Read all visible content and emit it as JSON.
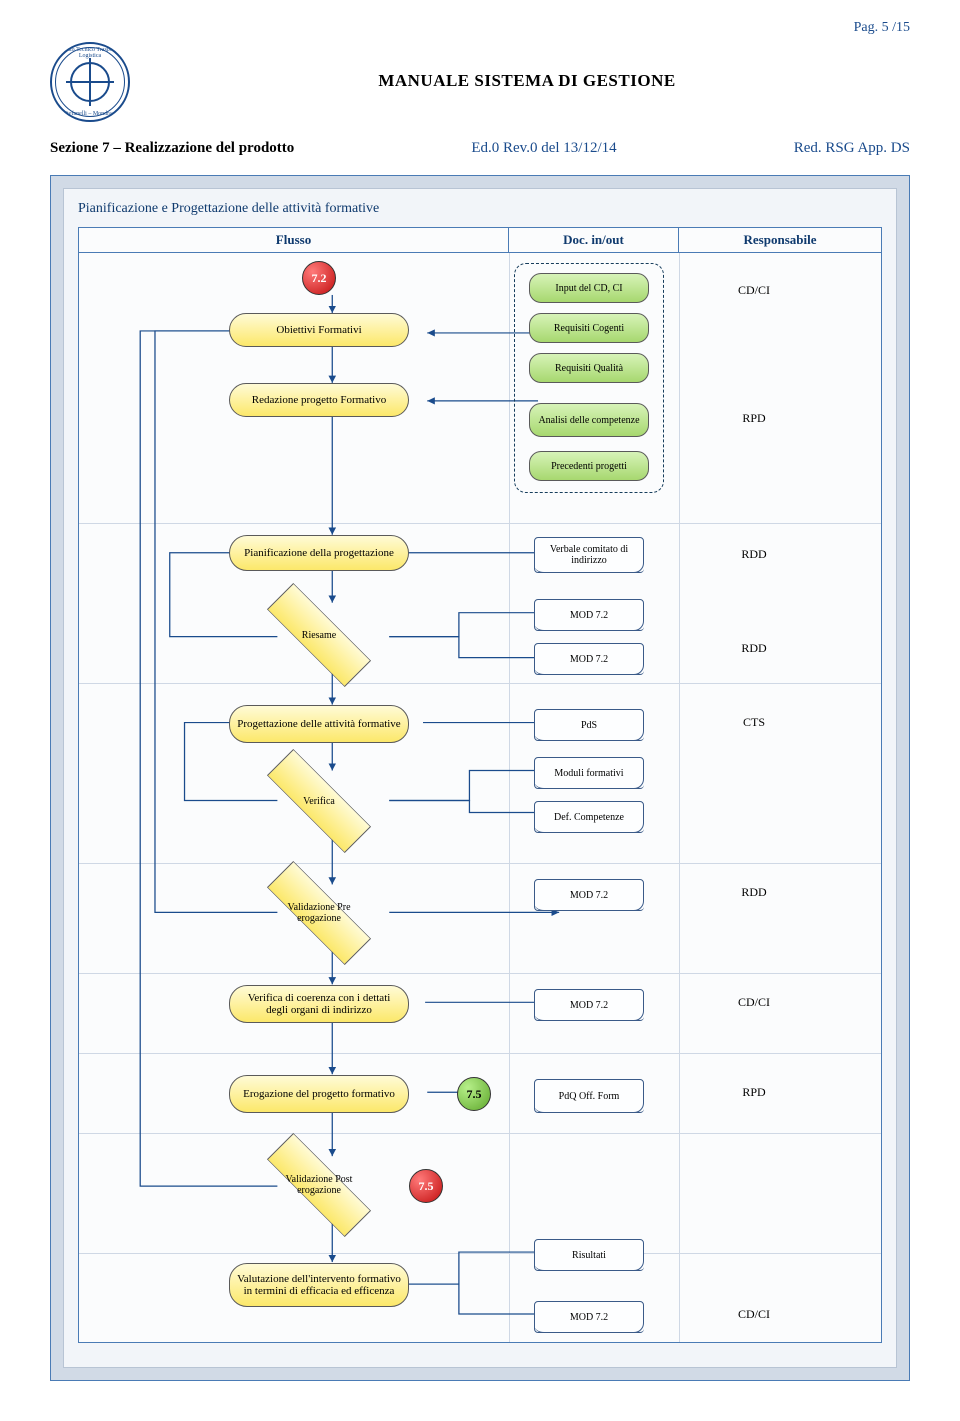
{
  "page_no": "Pag. 5 /15",
  "doc_title": "MANUALE SISTEMA DI GESTIONE",
  "section": "Sezione 7 – Realizzazione del prodotto",
  "ed": "Ed.0 Rev.0 del 13/12/14",
  "red": "Red. RSG App. DS",
  "logo": {
    "top": "Istituto Tecnico Trasporti e Logistica",
    "bottom": "N. Stefanelli – Mondragone"
  },
  "panel_title": "Pianificazione e Progettazione delle attività formative",
  "hdr": {
    "c1": "Flusso",
    "c2": "Doc. in/out",
    "c3": "Responsabile"
  },
  "term1": "7.2",
  "term2": "7.5",
  "term3": "7.5",
  "proc": {
    "obiettivi": "Obiettivi Formativi",
    "redazione": "Redazione progetto Formativo",
    "pianif": "Pianificazione della progettazione",
    "riesame": "Riesame",
    "progett": "Progettazione delle attività formative",
    "verifica": "Verifica",
    "validpre": "Validazione Pre erogazione",
    "vercoer": "Verifica di coerenza con i dettati degli organi di indirizzo",
    "erog": "Erogazione del progetto formativo",
    "validpost": "Validazione Post erogazione",
    "valut": "Valutazione dell'intervento formativo in termini di efficacia ed efficenza"
  },
  "inp": {
    "input": "Input del CD, CI",
    "cogenti": "Requisiti Cogenti",
    "qualita": "Requisiti Qualità",
    "analisi": "Analisi delle competenze",
    "precedenti": "Precedenti progetti"
  },
  "doc": {
    "verbale": "Verbale comitato di indirizzo",
    "mod72a": "MOD 7.2",
    "mod72b": "MOD 7.2",
    "pds": "PdS",
    "moduli": "Moduli formativi",
    "defcomp": "Def. Competenze",
    "mod72c": "MOD 7.2",
    "mod72d": "MOD 7.2",
    "pdq": "PdQ Off. Form",
    "risultati": "Risultati",
    "mod72e": "MOD 7.2"
  },
  "resp": {
    "r1": "CD/CI",
    "r2": "RPD",
    "r3": "RDD",
    "r4": "RDD",
    "r5": "CTS",
    "r6": "RDD",
    "r7": "CD/CI",
    "r8": "RPD",
    "r9": "CD/CI"
  }
}
